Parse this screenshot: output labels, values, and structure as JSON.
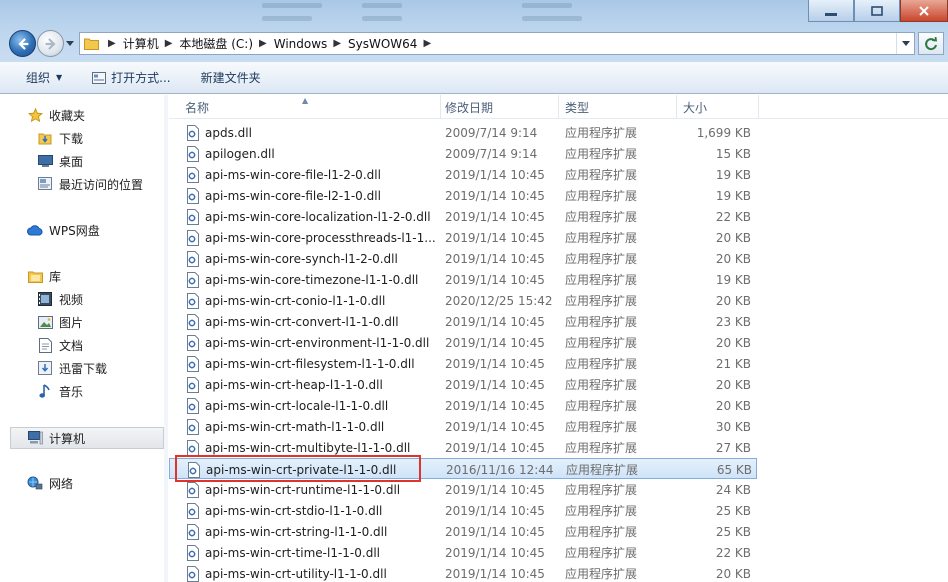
{
  "window": {
    "address": {
      "crumbs": [
        "计算机",
        "本地磁盘 (C:)",
        "Windows",
        "SysWOW64"
      ]
    }
  },
  "toolbar": {
    "organize_label": "组织",
    "open_with_label": "打开方式...",
    "new_folder_label": "新建文件夹"
  },
  "nav": {
    "favorites": {
      "label": "收藏夹",
      "items": [
        "下载",
        "桌面",
        "最近访问的位置"
      ]
    },
    "wps": {
      "label": "WPS网盘"
    },
    "library": {
      "label": "库",
      "items": [
        "视频",
        "图片",
        "文档",
        "迅雷下载",
        "音乐"
      ]
    },
    "computer": {
      "label": "计算机"
    },
    "network": {
      "label": "网络"
    }
  },
  "columns": {
    "name": "名称",
    "date": "修改日期",
    "type": "类型",
    "size": "大小"
  },
  "files": [
    {
      "name": "apds.dll",
      "date": "2009/7/14 9:14",
      "type": "应用程序扩展",
      "size": "1,699 KB"
    },
    {
      "name": "apilogen.dll",
      "date": "2009/7/14 9:14",
      "type": "应用程序扩展",
      "size": "15 KB"
    },
    {
      "name": "api-ms-win-core-file-l1-2-0.dll",
      "date": "2019/1/14 10:45",
      "type": "应用程序扩展",
      "size": "19 KB"
    },
    {
      "name": "api-ms-win-core-file-l2-1-0.dll",
      "date": "2019/1/14 10:45",
      "type": "应用程序扩展",
      "size": "19 KB"
    },
    {
      "name": "api-ms-win-core-localization-l1-2-0.dll",
      "date": "2019/1/14 10:45",
      "type": "应用程序扩展",
      "size": "22 KB"
    },
    {
      "name": "api-ms-win-core-processthreads-l1-1...",
      "date": "2019/1/14 10:45",
      "type": "应用程序扩展",
      "size": "20 KB"
    },
    {
      "name": "api-ms-win-core-synch-l1-2-0.dll",
      "date": "2019/1/14 10:45",
      "type": "应用程序扩展",
      "size": "20 KB"
    },
    {
      "name": "api-ms-win-core-timezone-l1-1-0.dll",
      "date": "2019/1/14 10:45",
      "type": "应用程序扩展",
      "size": "19 KB"
    },
    {
      "name": "api-ms-win-crt-conio-l1-1-0.dll",
      "date": "2020/12/25 15:42",
      "type": "应用程序扩展",
      "size": "20 KB"
    },
    {
      "name": "api-ms-win-crt-convert-l1-1-0.dll",
      "date": "2019/1/14 10:45",
      "type": "应用程序扩展",
      "size": "23 KB"
    },
    {
      "name": "api-ms-win-crt-environment-l1-1-0.dll",
      "date": "2019/1/14 10:45",
      "type": "应用程序扩展",
      "size": "20 KB"
    },
    {
      "name": "api-ms-win-crt-filesystem-l1-1-0.dll",
      "date": "2019/1/14 10:45",
      "type": "应用程序扩展",
      "size": "21 KB"
    },
    {
      "name": "api-ms-win-crt-heap-l1-1-0.dll",
      "date": "2019/1/14 10:45",
      "type": "应用程序扩展",
      "size": "20 KB"
    },
    {
      "name": "api-ms-win-crt-locale-l1-1-0.dll",
      "date": "2019/1/14 10:45",
      "type": "应用程序扩展",
      "size": "20 KB"
    },
    {
      "name": "api-ms-win-crt-math-l1-1-0.dll",
      "date": "2019/1/14 10:45",
      "type": "应用程序扩展",
      "size": "30 KB"
    },
    {
      "name": "api-ms-win-crt-multibyte-l1-1-0.dll",
      "date": "2019/1/14 10:45",
      "type": "应用程序扩展",
      "size": "27 KB"
    },
    {
      "name": "api-ms-win-crt-private-l1-1-0.dll",
      "date": "2016/11/16 12:44",
      "type": "应用程序扩展",
      "size": "65 KB"
    },
    {
      "name": "api-ms-win-crt-runtime-l1-1-0.dll",
      "date": "2019/1/14 10:45",
      "type": "应用程序扩展",
      "size": "24 KB"
    },
    {
      "name": "api-ms-win-crt-stdio-l1-1-0.dll",
      "date": "2019/1/14 10:45",
      "type": "应用程序扩展",
      "size": "25 KB"
    },
    {
      "name": "api-ms-win-crt-string-l1-1-0.dll",
      "date": "2019/1/14 10:45",
      "type": "应用程序扩展",
      "size": "25 KB"
    },
    {
      "name": "api-ms-win-crt-time-l1-1-0.dll",
      "date": "2019/1/14 10:45",
      "type": "应用程序扩展",
      "size": "22 KB"
    },
    {
      "name": "api-ms-win-crt-utility-l1-1-0.dll",
      "date": "2019/1/14 10:45",
      "type": "应用程序扩展",
      "size": "20 KB"
    }
  ],
  "selected_file": "api-ms-win-crt-private-l1-1-0.dll",
  "colors": {
    "highlight": "#e0332c",
    "selection": "#cfe4f8"
  }
}
